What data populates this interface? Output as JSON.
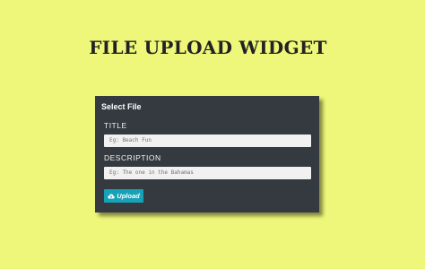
{
  "header": {
    "title": "FILE UPLOAD WIDGET"
  },
  "panel": {
    "heading": "Select File",
    "fields": [
      {
        "label": "TITLE",
        "placeholder": "Eg: Beach Fun",
        "value": ""
      },
      {
        "label": "DESCRIPTION",
        "placeholder": "Eg: The one in the Bahamas",
        "value": ""
      }
    ],
    "upload_button": {
      "label": "Upload",
      "icon": "cloud-upload-icon"
    }
  },
  "colors": {
    "background": "#eef77a",
    "panel": "#343a40",
    "button": "#17a2b8",
    "input": "#f1f1f1"
  }
}
